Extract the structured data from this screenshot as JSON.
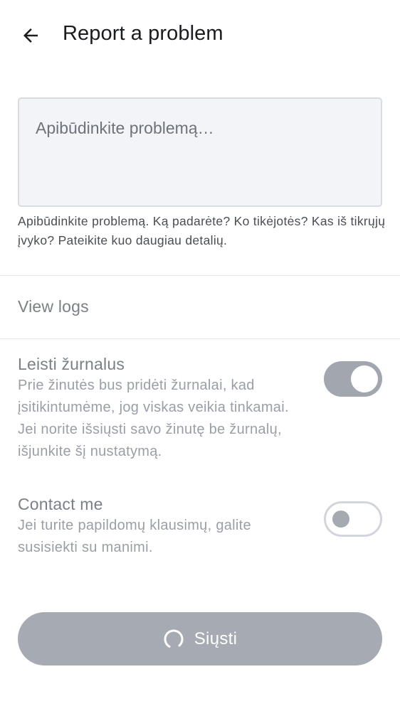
{
  "header": {
    "back_icon": "arrow-left-icon",
    "title": "Report a problem"
  },
  "description": {
    "value": "",
    "placeholder": "Apibūdinkite problemą…",
    "helper": "Apibūdinkite problemą. Ką padarėte? Ko tikėjotės? Kas iš tikrųjų įvyko? Pateikite kuo daugiau detalių."
  },
  "view_logs": {
    "label": "View logs"
  },
  "settings": [
    {
      "title": "Leisti žurnalus",
      "description": "Prie žinutės bus pridėti žurnalai, kad įsitikintumėme, jog viskas veikia tinkamai. Jei norite išsiųsti savo žinutę be žurnalų, išjunkite šį nustatymą.",
      "enabled": true
    },
    {
      "title": "Contact me",
      "description": "Jei turite papildomų klausimų, galite susisiekti su manimi.",
      "enabled": false
    }
  ],
  "send_button": {
    "label": "Siųsti",
    "loading": true,
    "icon": "spinner-icon"
  },
  "colors": {
    "button_disabled": "#a6abb3",
    "toggle_on": "#a2a7af",
    "toggle_off_border": "#d2d6dc",
    "input_bg": "#f3f4f7"
  }
}
